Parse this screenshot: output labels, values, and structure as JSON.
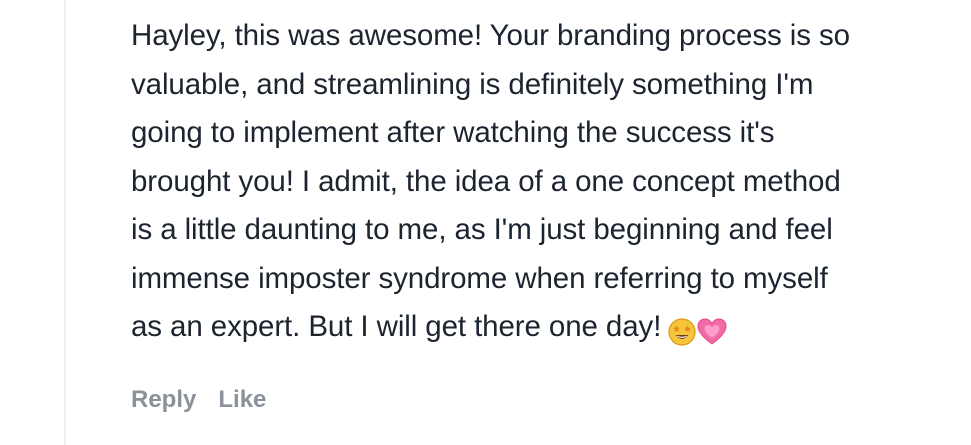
{
  "comment": {
    "lines": [
      "Hayley, this was awesome! Your branding process is so",
      "valuable, and streamlining is definitely something I'm",
      "going to implement after watching the success it's",
      "brought you! I admit, the idea of a one concept method",
      "is a little daunting to me, as I'm just beginning and feel",
      "immense imposter syndrome when referring to myself",
      "as an expert. But I will get there one day!"
    ],
    "emojis": [
      "star-struck-emoji",
      "growing-heart-emoji"
    ]
  },
  "actions": {
    "reply_label": "Reply",
    "like_label": "Like"
  },
  "colors": {
    "text": "#1c2430",
    "action_text": "#8a919b",
    "thread_line": "#eef0f3"
  }
}
